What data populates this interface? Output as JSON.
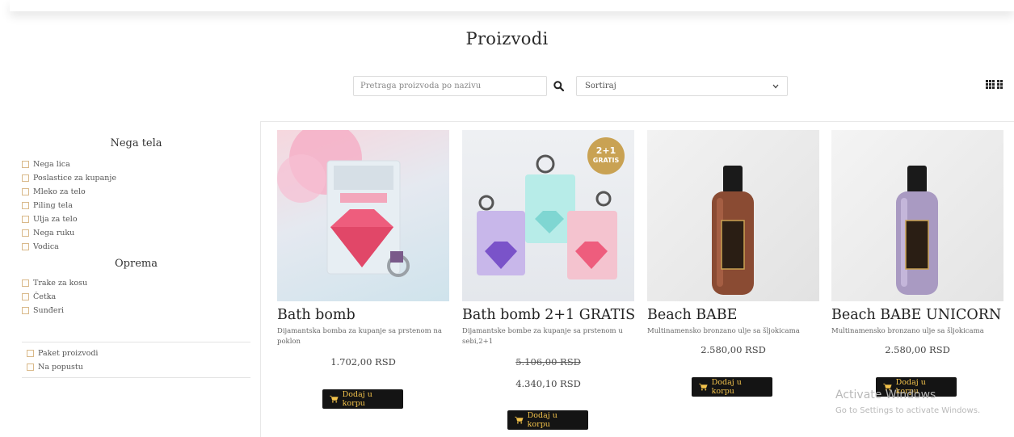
{
  "header": {
    "title": "Proizvodi"
  },
  "toolbar": {
    "search_placeholder": "Pretraga proizvoda po nazivu",
    "search_icon": "search-icon",
    "sort_label": "Sortiraj",
    "sort_icon": "chevron-down-icon",
    "view_icons": [
      "grid-view-icon",
      "list-view-icon"
    ]
  },
  "sidebar": {
    "groups": [
      {
        "heading": "Nega tela",
        "items": [
          "Nega lica",
          "Poslastice za kupanje",
          "Mleko za telo",
          "Piling tela",
          "Ulja za telo",
          "Nega ruku",
          "Vodica"
        ]
      },
      {
        "heading": "Oprema",
        "items": [
          "Trake za kosu",
          "Četka",
          "Sunđeri"
        ]
      }
    ],
    "extra": [
      "Paket proizvodi",
      "Na popustu"
    ]
  },
  "products": [
    {
      "title": "Bath bomb",
      "desc": "Dijamantska bomba za kupanje sa prstenom na poklon",
      "price": "1.702,00 RSD",
      "button": "Dodaj u korpu"
    },
    {
      "title": "Bath bomb 2+1 GRATIS",
      "desc": "Dijamantske bombe za kupanje sa prstenom u sebi,2+1",
      "price_old": "5.106,00 RSD",
      "price": "4.340,10 RSD",
      "button": "Dodaj u korpu",
      "badge_line1": "2+1",
      "badge_line2": "GRATIS"
    },
    {
      "title": "Beach BABE",
      "desc": "Multinamensko bronzano ulje sa šljokicama",
      "price": "2.580,00 RSD",
      "button": "Dodaj u korpu"
    },
    {
      "title": "Beach BABE UNICORN",
      "desc": "Multinamensko bronzano ulje sa šljokicama",
      "price": "2.580,00 RSD",
      "button": "Dodaj u korpu"
    }
  ],
  "watermark": {
    "line1": "Activate Windows",
    "line2": "Go to Settings to activate Windows."
  },
  "colors": {
    "button_bg": "#141414",
    "button_text": "#f2c24b",
    "checkbox_border": "#d9b98a"
  }
}
